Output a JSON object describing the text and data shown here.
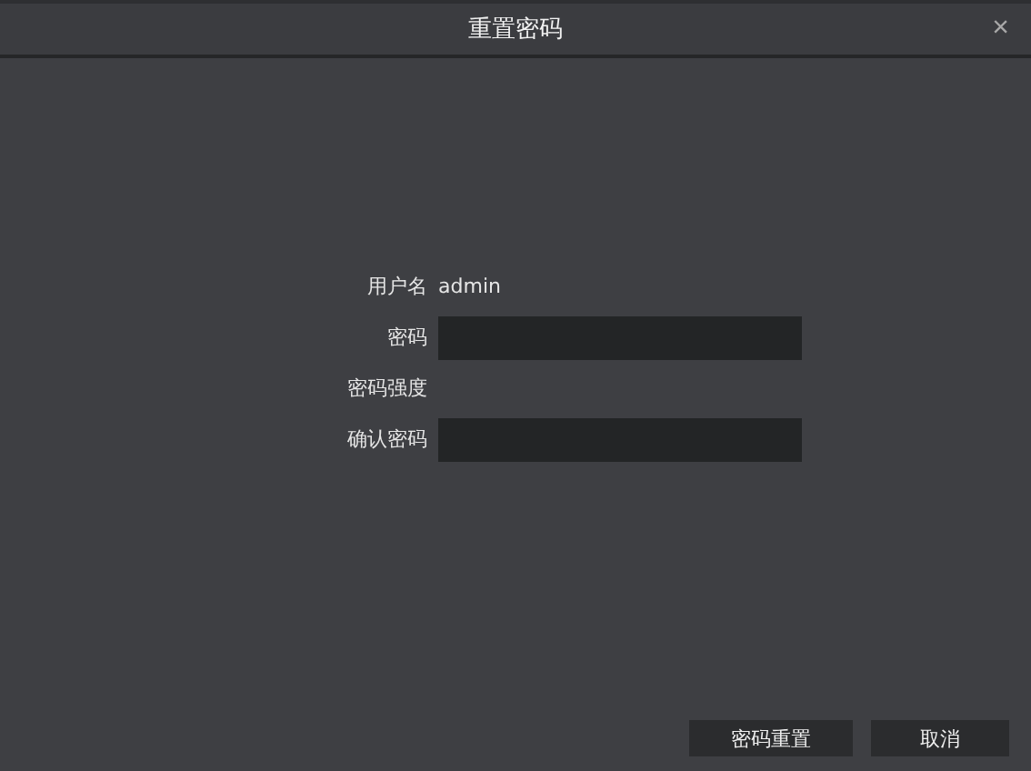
{
  "window": {
    "title": "重置密码",
    "close": "×"
  },
  "form": {
    "rows": [
      {
        "kind": "text",
        "label": "用户名",
        "value": "admin"
      },
      {
        "kind": "field",
        "label": "密码"
      },
      {
        "kind": "text",
        "label": "密码强度"
      },
      {
        "kind": "field",
        "label": "确认密码"
      }
    ]
  },
  "buttons": [
    "密码重置",
    "取消"
  ]
}
